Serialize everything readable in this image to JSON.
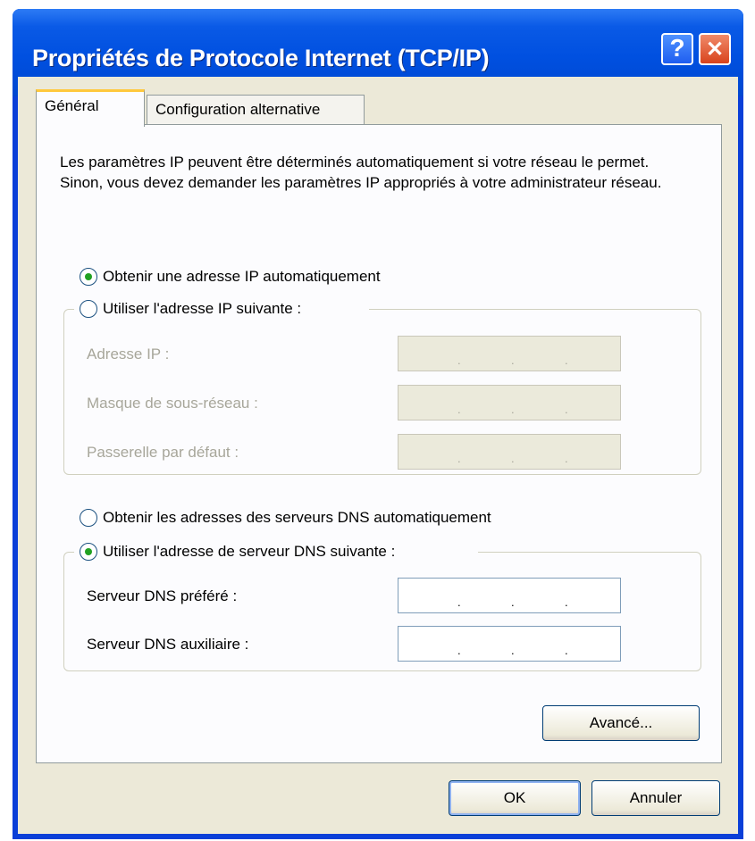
{
  "window": {
    "title": "Propriétés de Protocole Internet (TCP/IP)",
    "help_glyph": "?",
    "close_glyph": "✕"
  },
  "tabs": [
    {
      "label": "Général",
      "active": true
    },
    {
      "label": "Configuration alternative",
      "active": false
    }
  ],
  "description": "Les paramètres IP peuvent être déterminés automatiquement si votre réseau le permet. Sinon, vous devez demander les paramètres IP appropriés à votre administrateur réseau.",
  "ip_section": {
    "auto_option": {
      "label": "Obtenir une adresse IP automatiquement",
      "checked": true
    },
    "manual_option": {
      "label": "Utiliser l'adresse IP suivante :",
      "checked": false
    },
    "fields": [
      {
        "label": "Adresse IP :",
        "value": ". . ."
      },
      {
        "label": "Masque de sous-réseau :",
        "value": ". . ."
      },
      {
        "label": "Passerelle par défaut :",
        "value": ". . ."
      }
    ]
  },
  "dns_section": {
    "auto_option": {
      "label": "Obtenir les adresses des serveurs DNS automatiquement",
      "checked": false
    },
    "manual_option": {
      "label": "Utiliser l'adresse de serveur DNS suivante :",
      "checked": true
    },
    "fields": [
      {
        "label": "Serveur DNS préféré :",
        "value": ". . ."
      },
      {
        "label": "Serveur DNS auxiliaire :",
        "value": ". . ."
      }
    ]
  },
  "buttons": {
    "advanced": "Avancé...",
    "ok": "OK",
    "cancel": "Annuler"
  },
  "colors": {
    "titlebar": "#0054e3",
    "dialog_bg": "#ece9d8",
    "tab_highlight": "#ffc83c",
    "radio_dot": "#21a121"
  }
}
